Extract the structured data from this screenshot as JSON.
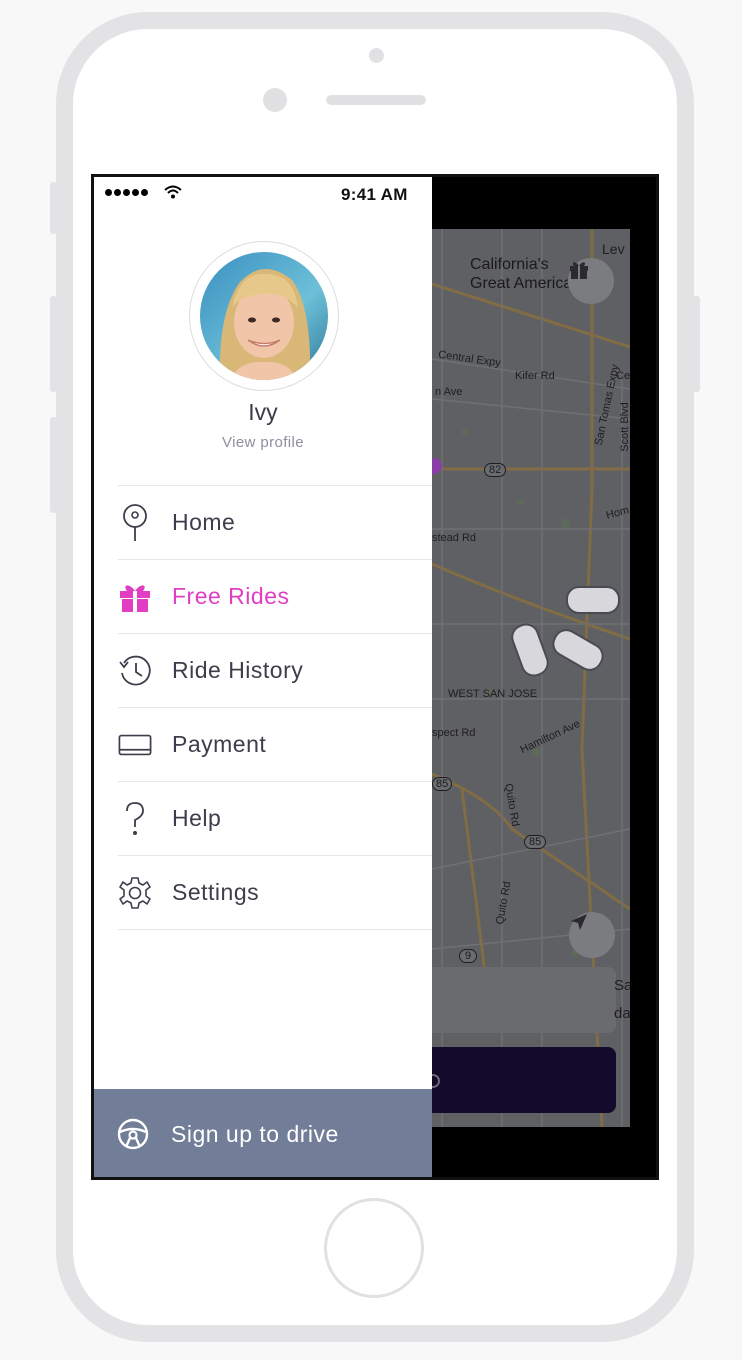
{
  "status_bar": {
    "time": "9:41 AM"
  },
  "profile": {
    "name": "Ivy",
    "link": "View profile"
  },
  "menu": [
    {
      "label": "Home",
      "icon": "home-pin-icon",
      "active": false
    },
    {
      "label": "Free Rides",
      "icon": "gift-icon",
      "active": true
    },
    {
      "label": "Ride History",
      "icon": "history-icon",
      "active": false
    },
    {
      "label": "Payment",
      "icon": "payment-card-icon",
      "active": false
    },
    {
      "label": "Help",
      "icon": "question-icon",
      "active": false
    },
    {
      "label": "Settings",
      "icon": "gear-icon",
      "active": false
    }
  ],
  "drive": {
    "label": "Sign up to drive",
    "icon": "steering-wheel-icon"
  },
  "map": {
    "place_title_1": "California's",
    "place_title_2": "Great America",
    "place_lev": "Lev",
    "labels": {
      "central_expy": "Central Expy",
      "kifer_rd": "Kifer Rd",
      "n_ave": "n Ave",
      "san_tomas_expy": "San Tomas Expy",
      "scott_blvd": "Scott Blvd",
      "ce": "Ce",
      "route_82": "82",
      "hom": "Hom",
      "stead_rd": "stead Rd",
      "west_san_jose": "WEST SAN JOSE",
      "spect_rd": "spect Rd",
      "hamilton_ave": "Hamilton Ave",
      "route_85a": "85",
      "quito_rd_1": "Quito Rd",
      "route_85b": "85",
      "quito_rd_2": "Quito Rd",
      "route_9": "9",
      "card_sa": "Sa",
      "card_da": "da"
    }
  },
  "colors": {
    "accent": "#e13ec4",
    "drive_bar": "#727d98",
    "menu_text": "#3d3d4b",
    "map_overlay": "#5f6063",
    "cta": "#140a2c"
  }
}
